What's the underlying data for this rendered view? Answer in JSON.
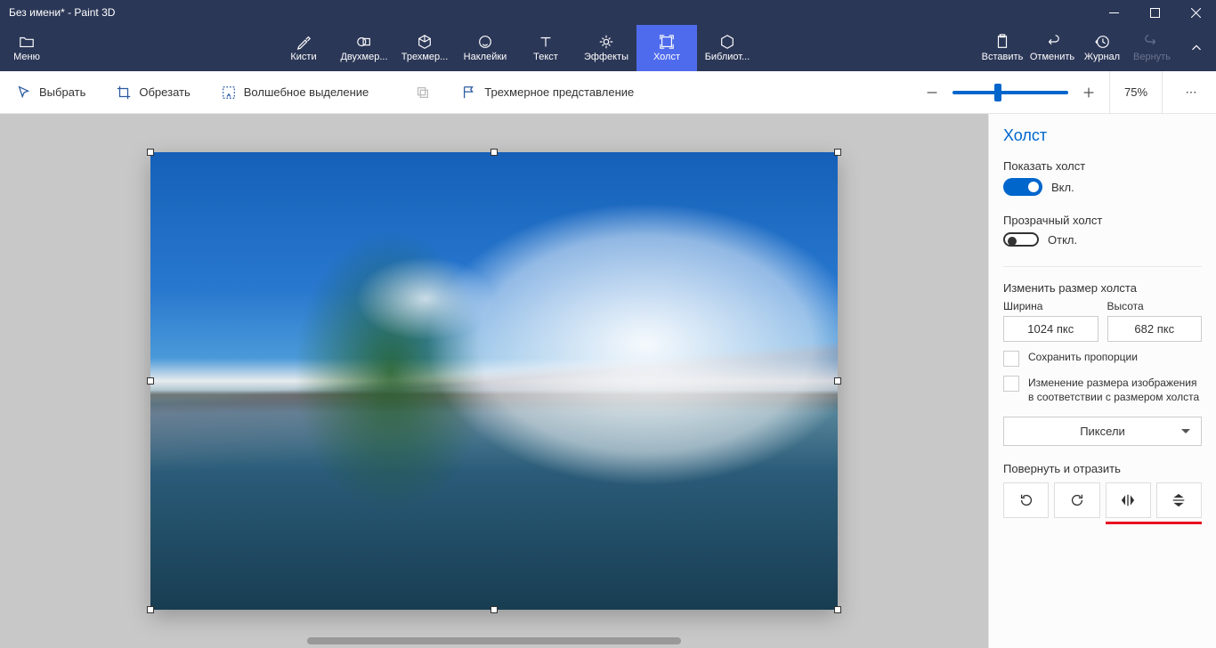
{
  "window": {
    "title": "Без имени* - Paint 3D"
  },
  "menu": {
    "label": "Меню"
  },
  "tools": [
    {
      "id": "brushes",
      "label": "Кисти"
    },
    {
      "id": "2d",
      "label": "Двухмер..."
    },
    {
      "id": "3d",
      "label": "Трехмер..."
    },
    {
      "id": "stickers",
      "label": "Наклейки"
    },
    {
      "id": "text",
      "label": "Текст"
    },
    {
      "id": "effects",
      "label": "Эффекты"
    },
    {
      "id": "canvas",
      "label": "Холст",
      "active": true
    },
    {
      "id": "library",
      "label": "Библиот..."
    }
  ],
  "right_tools": {
    "paste": "Вставить",
    "undo": "Отменить",
    "history": "Журнал",
    "redo": "Вернуть"
  },
  "secondary": {
    "select": "Выбрать",
    "crop": "Обрезать",
    "magic": "Волшебное выделение",
    "view3d": "Трехмерное представление",
    "zoom_pct": "75%"
  },
  "panel": {
    "title": "Холст",
    "show_canvas": "Показать холст",
    "show_on": "Вкл.",
    "transparent": "Прозрачный холст",
    "transparent_off": "Откл.",
    "resize_title": "Изменить размер холста",
    "width_label": "Ширина",
    "height_label": "Высота",
    "width_value": "1024 пкс",
    "height_value": "682 пкс",
    "lock_aspect": "Сохранить пропорции",
    "resize_image": "Изменение размера изображения в соответствии с размером холста",
    "units": "Пиксели",
    "rotate_title": "Повернуть и отразить"
  }
}
